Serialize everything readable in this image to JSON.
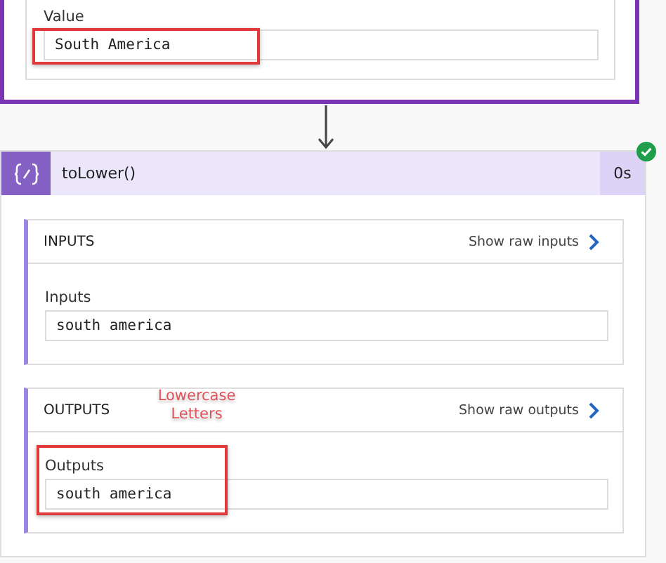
{
  "previous_action": {
    "field": {
      "label": "Value",
      "value": "South America",
      "highlighted": true
    }
  },
  "action": {
    "title": "toLower()",
    "duration": "0s",
    "succeeded": true,
    "sections": [
      {
        "heading": "INPUTS",
        "link": "Show raw inputs",
        "field_label": "Inputs",
        "field_value": "south america",
        "highlighted": false
      },
      {
        "heading": "OUTPUTS",
        "link": "Show raw outputs",
        "annotation": "Lowercase Letters",
        "field_label": "Outputs",
        "field_value": "south america",
        "highlighted": true
      }
    ]
  }
}
